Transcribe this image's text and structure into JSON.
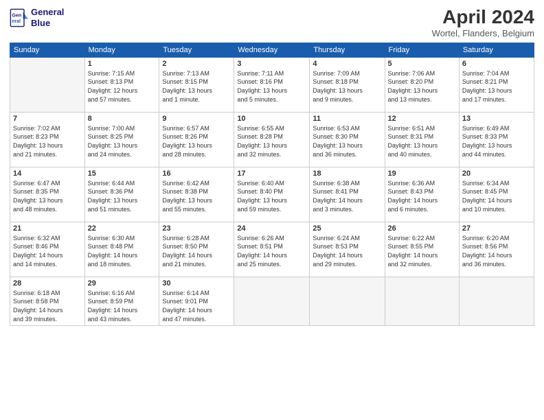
{
  "header": {
    "logo_line1": "General",
    "logo_line2": "Blue",
    "title": "April 2024",
    "location": "Wortel, Flanders, Belgium"
  },
  "days_of_week": [
    "Sunday",
    "Monday",
    "Tuesday",
    "Wednesday",
    "Thursday",
    "Friday",
    "Saturday"
  ],
  "weeks": [
    [
      {
        "day": "",
        "info": ""
      },
      {
        "day": "1",
        "info": "Sunrise: 7:15 AM\nSunset: 8:13 PM\nDaylight: 12 hours\nand 57 minutes."
      },
      {
        "day": "2",
        "info": "Sunrise: 7:13 AM\nSunset: 8:15 PM\nDaylight: 13 hours\nand 1 minute."
      },
      {
        "day": "3",
        "info": "Sunrise: 7:11 AM\nSunset: 8:16 PM\nDaylight: 13 hours\nand 5 minutes."
      },
      {
        "day": "4",
        "info": "Sunrise: 7:09 AM\nSunset: 8:18 PM\nDaylight: 13 hours\nand 9 minutes."
      },
      {
        "day": "5",
        "info": "Sunrise: 7:06 AM\nSunset: 8:20 PM\nDaylight: 13 hours\nand 13 minutes."
      },
      {
        "day": "6",
        "info": "Sunrise: 7:04 AM\nSunset: 8:21 PM\nDaylight: 13 hours\nand 17 minutes."
      }
    ],
    [
      {
        "day": "7",
        "info": "Sunrise: 7:02 AM\nSunset: 8:23 PM\nDaylight: 13 hours\nand 21 minutes."
      },
      {
        "day": "8",
        "info": "Sunrise: 7:00 AM\nSunset: 8:25 PM\nDaylight: 13 hours\nand 24 minutes."
      },
      {
        "day": "9",
        "info": "Sunrise: 6:57 AM\nSunset: 8:26 PM\nDaylight: 13 hours\nand 28 minutes."
      },
      {
        "day": "10",
        "info": "Sunrise: 6:55 AM\nSunset: 8:28 PM\nDaylight: 13 hours\nand 32 minutes."
      },
      {
        "day": "11",
        "info": "Sunrise: 6:53 AM\nSunset: 8:30 PM\nDaylight: 13 hours\nand 36 minutes."
      },
      {
        "day": "12",
        "info": "Sunrise: 6:51 AM\nSunset: 8:31 PM\nDaylight: 13 hours\nand 40 minutes."
      },
      {
        "day": "13",
        "info": "Sunrise: 6:49 AM\nSunset: 8:33 PM\nDaylight: 13 hours\nand 44 minutes."
      }
    ],
    [
      {
        "day": "14",
        "info": "Sunrise: 6:47 AM\nSunset: 8:35 PM\nDaylight: 13 hours\nand 48 minutes."
      },
      {
        "day": "15",
        "info": "Sunrise: 6:44 AM\nSunset: 8:36 PM\nDaylight: 13 hours\nand 51 minutes."
      },
      {
        "day": "16",
        "info": "Sunrise: 6:42 AM\nSunset: 8:38 PM\nDaylight: 13 hours\nand 55 minutes."
      },
      {
        "day": "17",
        "info": "Sunrise: 6:40 AM\nSunset: 8:40 PM\nDaylight: 13 hours\nand 59 minutes."
      },
      {
        "day": "18",
        "info": "Sunrise: 6:38 AM\nSunset: 8:41 PM\nDaylight: 14 hours\nand 3 minutes."
      },
      {
        "day": "19",
        "info": "Sunrise: 6:36 AM\nSunset: 8:43 PM\nDaylight: 14 hours\nand 6 minutes."
      },
      {
        "day": "20",
        "info": "Sunrise: 6:34 AM\nSunset: 8:45 PM\nDaylight: 14 hours\nand 10 minutes."
      }
    ],
    [
      {
        "day": "21",
        "info": "Sunrise: 6:32 AM\nSunset: 8:46 PM\nDaylight: 14 hours\nand 14 minutes."
      },
      {
        "day": "22",
        "info": "Sunrise: 6:30 AM\nSunset: 8:48 PM\nDaylight: 14 hours\nand 18 minutes."
      },
      {
        "day": "23",
        "info": "Sunrise: 6:28 AM\nSunset: 8:50 PM\nDaylight: 14 hours\nand 21 minutes."
      },
      {
        "day": "24",
        "info": "Sunrise: 6:26 AM\nSunset: 8:51 PM\nDaylight: 14 hours\nand 25 minutes."
      },
      {
        "day": "25",
        "info": "Sunrise: 6:24 AM\nSunset: 8:53 PM\nDaylight: 14 hours\nand 29 minutes."
      },
      {
        "day": "26",
        "info": "Sunrise: 6:22 AM\nSunset: 8:55 PM\nDaylight: 14 hours\nand 32 minutes."
      },
      {
        "day": "27",
        "info": "Sunrise: 6:20 AM\nSunset: 8:56 PM\nDaylight: 14 hours\nand 36 minutes."
      }
    ],
    [
      {
        "day": "28",
        "info": "Sunrise: 6:18 AM\nSunset: 8:58 PM\nDaylight: 14 hours\nand 39 minutes."
      },
      {
        "day": "29",
        "info": "Sunrise: 6:16 AM\nSunset: 8:59 PM\nDaylight: 14 hours\nand 43 minutes."
      },
      {
        "day": "30",
        "info": "Sunrise: 6:14 AM\nSunset: 9:01 PM\nDaylight: 14 hours\nand 47 minutes."
      },
      {
        "day": "",
        "info": ""
      },
      {
        "day": "",
        "info": ""
      },
      {
        "day": "",
        "info": ""
      },
      {
        "day": "",
        "info": ""
      }
    ]
  ]
}
